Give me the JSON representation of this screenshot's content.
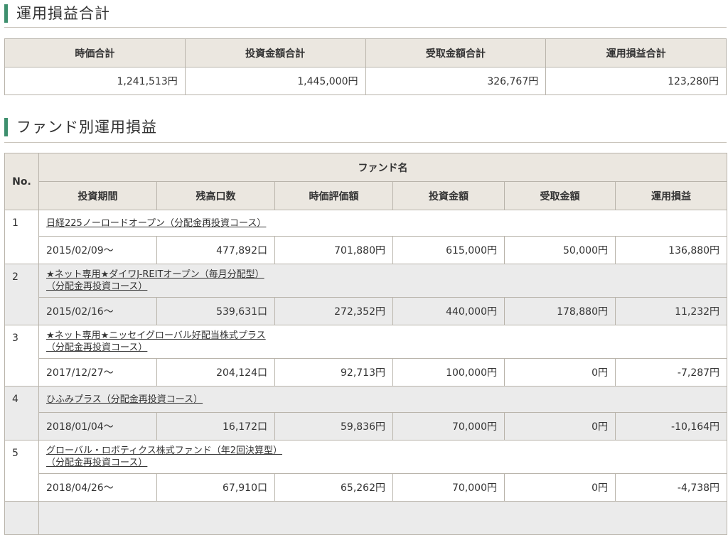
{
  "summary": {
    "title": "運用損益合計",
    "headers": [
      "時価合計",
      "投資金額合計",
      "受取金額合計",
      "運用損益合計"
    ],
    "values": [
      "1,241,513円",
      "1,445,000円",
      "326,767円",
      "123,280円"
    ]
  },
  "funds_section": {
    "title": "ファンド別運用損益",
    "header_no": "No.",
    "header_fund_name": "ファンド名",
    "columns": [
      "投資期間",
      "残高口数",
      "時価評価額",
      "投資金額",
      "受取金額",
      "運用損益"
    ],
    "rows": [
      {
        "no": "1",
        "name_line1": "日経225ノーロードオープン（分配金再投資コース）",
        "name_line2": "",
        "period": "2015/02/09〜",
        "units": "477,892口",
        "market_value": "701,880円",
        "invested": "615,000円",
        "received": "50,000円",
        "pnl": "136,880円"
      },
      {
        "no": "2",
        "name_line1": "★ネット専用★ダイワJ-REITオープン（毎月分配型）",
        "name_line2": "（分配金再投資コース）",
        "period": "2015/02/16〜",
        "units": "539,631口",
        "market_value": "272,352円",
        "invested": "440,000円",
        "received": "178,880円",
        "pnl": "11,232円"
      },
      {
        "no": "3",
        "name_line1": "★ネット専用★ニッセイグローバル好配当株式プラス",
        "name_line2": "（分配金再投資コース）",
        "period": "2017/12/27〜",
        "units": "204,124口",
        "market_value": "92,713円",
        "invested": "100,000円",
        "received": "0円",
        "pnl": "-7,287円"
      },
      {
        "no": "4",
        "name_line1": "ひふみプラス（分配金再投資コース）",
        "name_line2": "",
        "period": "2018/01/04〜",
        "units": "16,172口",
        "market_value": "59,836円",
        "invested": "70,000円",
        "received": "0円",
        "pnl": "-10,164円"
      },
      {
        "no": "5",
        "name_line1": "グローバル・ロボティクス株式ファンド（年2回決算型）",
        "name_line2": "（分配金再投資コース）",
        "period": "2018/04/26〜",
        "units": "67,910口",
        "market_value": "65,262円",
        "invested": "70,000円",
        "received": "0円",
        "pnl": "-4,738円"
      }
    ]
  }
}
